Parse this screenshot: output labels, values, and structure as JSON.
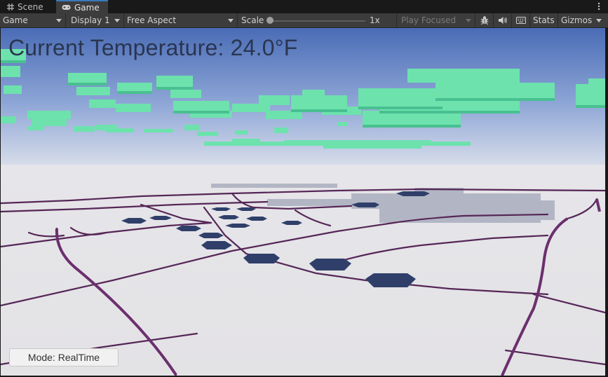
{
  "tabs": [
    {
      "label": "Scene",
      "icon": "grid-hash-icon",
      "active": false
    },
    {
      "label": "Game",
      "icon": "gamepad-icon",
      "active": true
    }
  ],
  "toolbar": {
    "view_dropdown": "Game",
    "display_dropdown": "Display 1",
    "aspect_dropdown": "Free Aspect",
    "scale_label": "Scale",
    "scale_value": "1x",
    "scale_fraction": 0.0,
    "play_mode_dropdown": "Play Focused",
    "stats_label": "Stats",
    "gizmos_label": "Gizmos",
    "icons": [
      "bug-icon",
      "speaker-icon",
      "keyboard-icon"
    ]
  },
  "game_view": {
    "temperature_text": "Current Temperature: 24.0°F",
    "mode_button_label": "Mode: RealTime"
  },
  "colors": {
    "editor_background": "#191919",
    "toolbar_background": "#3c3c3c",
    "sky_top": "#4b6eb8",
    "sky_horizon": "#c9d3e8",
    "ground": "#e4e3e6",
    "clouds": "#6ee3ae",
    "roads": "#5a2a5c",
    "shadows": "#2f3f6a",
    "temperature_text": "#2a3550"
  }
}
